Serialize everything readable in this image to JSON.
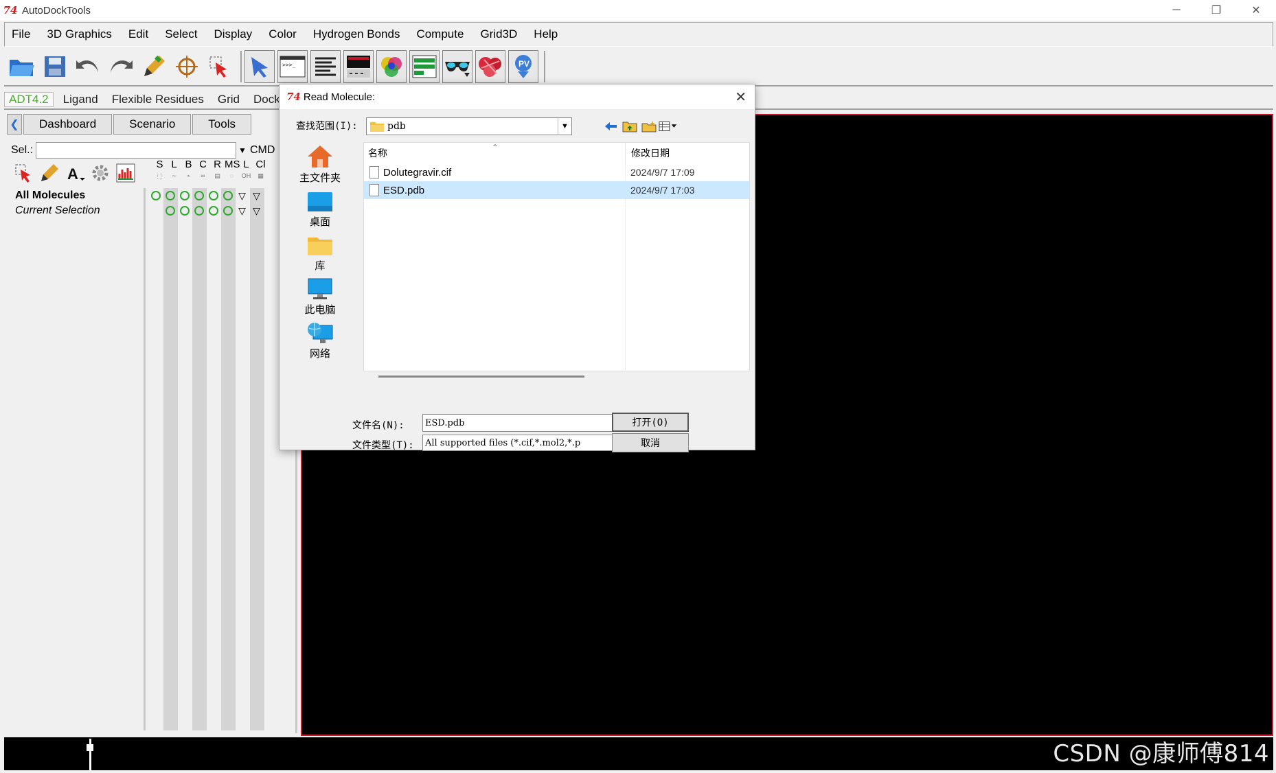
{
  "window": {
    "app_logo": "74",
    "title": "AutoDockTools",
    "controls": [
      "─",
      "❐",
      "✕"
    ]
  },
  "menubar": [
    "File",
    "3D Graphics",
    "Edit",
    "Select",
    "Display",
    "Color",
    "Hydrogen Bonds",
    "Compute",
    "Grid3D",
    "Help"
  ],
  "adt_tabs": [
    "ADT4.2",
    "Ligand",
    "Flexible Residues",
    "Grid",
    "Docking"
  ],
  "left_panel": {
    "nav_tabs": [
      "Dashboard",
      "Scenario",
      "Tools"
    ],
    "sel_label": "Sel.:",
    "sel_value": "",
    "cmd_label": "CMD",
    "column_headers": [
      {
        "label": "S",
        "sub": "⬚"
      },
      {
        "label": "L",
        "sub": "∼"
      },
      {
        "label": "B",
        "sub": "⌁"
      },
      {
        "label": "C",
        "sub": "∞"
      },
      {
        "label": "R",
        "sub": "▤"
      },
      {
        "label": "MS",
        "sub": "◌"
      },
      {
        "label": "L",
        "sub": "OH"
      },
      {
        "label": "Cl",
        "sub": "▦"
      }
    ],
    "rows": [
      {
        "label": "All Molecules",
        "style": "bold"
      },
      {
        "label": "Current Selection",
        "style": "italic"
      }
    ]
  },
  "dialog": {
    "logo": "74",
    "title": "Read Molecule:",
    "look_in_label": "查找范围(I):",
    "look_in_value": "pdb",
    "places": [
      "主文件夹",
      "桌面",
      "库",
      "此电脑",
      "网络"
    ],
    "columns": {
      "name": "名称",
      "date": "修改日期"
    },
    "files": [
      {
        "name": "Dolutegravir.cif",
        "date": "2024/9/7 17:09",
        "selected": false
      },
      {
        "name": "ESD.pdb",
        "date": "2024/9/7 17:03",
        "selected": true
      }
    ],
    "filename_label": "文件名(N):",
    "filename_value": "ESD.pdb",
    "filetype_label": "文件类型(T):",
    "filetype_value": "All supported files (*.cif,*.mol2,*.p",
    "open_label": "打开(O)",
    "cancel_label": "取消"
  },
  "watermark": "CSDN @康师傅814",
  "colors": {
    "viewer_border": "#c8162a",
    "selected_row": "#cce8ff",
    "adt_active": "#4caf2a",
    "visibility_circle": "#2fa82f"
  }
}
